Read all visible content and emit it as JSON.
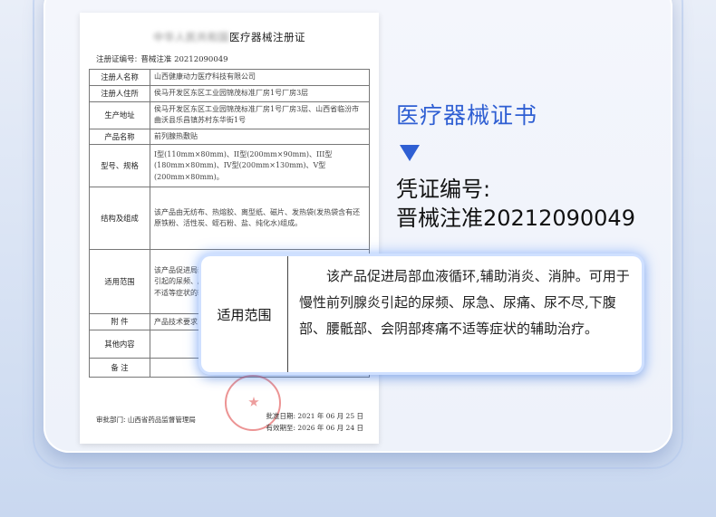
{
  "certificate": {
    "title_blurred": "中华人民共和国",
    "title": "医疗器械注册证",
    "number_label": "注册证编号:",
    "number_value": "晋械注准 20212090049",
    "rows": [
      {
        "key": "注册人名称",
        "value": "山西健康动力医疗科技有限公司"
      },
      {
        "key": "注册人住所",
        "value": "侯马开发区东区工业园锦茂标准厂房1号厂房3层"
      },
      {
        "key": "生产地址",
        "value": "侯马开发区东区工业园锦茂标准厂房1号厂房3层、山西省临汾市曲沃县乐昌镇苏村东华街1号"
      },
      {
        "key": "产品名称",
        "value": "前列腺热敷贴"
      },
      {
        "key": "型号、规格",
        "value": "I型(110mm×80mm)、II型(200mm×90mm)、III型(180mm×80mm)、IV型(200mm×130mm)、V型(200mm×80mm)。"
      },
      {
        "key": "结构及组成",
        "value": "该产品由无纺布、热熔胶、离型纸、磁片、发热袋(发热袋含有还原铁粉、活性炭、蛭石粉、盐、纯化水)组成。"
      },
      {
        "key": "适用范围",
        "value": "该产品促进局部血液循环,辅助消炎、消肿。可用于慢性前列腺炎引起的尿频、尿急、尿痛、尿不尽,下腹部、腰骶部、会阴部疼痛不适等症状的辅助治疗。"
      },
      {
        "key": "附 件",
        "value": "产品技术要求"
      },
      {
        "key": "其他内容",
        "value": ""
      },
      {
        "key": "备 注",
        "value": ""
      }
    ],
    "approver_label": "审批部门:",
    "approver": "山西省药品监督管理局",
    "approval_date": "批准日期: 2021 年 06 月 25 日",
    "expiry_date": "有效期至: 2026 年 06 月 24 日"
  },
  "heading": "医疗器械证书",
  "cert_number_caption": "凭证编号:",
  "cert_number": "晋械注准20212090049",
  "popup": {
    "key": "适用范围",
    "value": "该产品促进局部血液循环,辅助消炎、消肿。可用于慢性前列腺炎引起的尿频、尿急、尿痛、尿不尽,下腹部、腰骶部、会阴部疼痛不适等症状的辅助治疗。"
  },
  "colors": {
    "accent": "#2f5fd3",
    "stamp": "#dc3c3c"
  }
}
